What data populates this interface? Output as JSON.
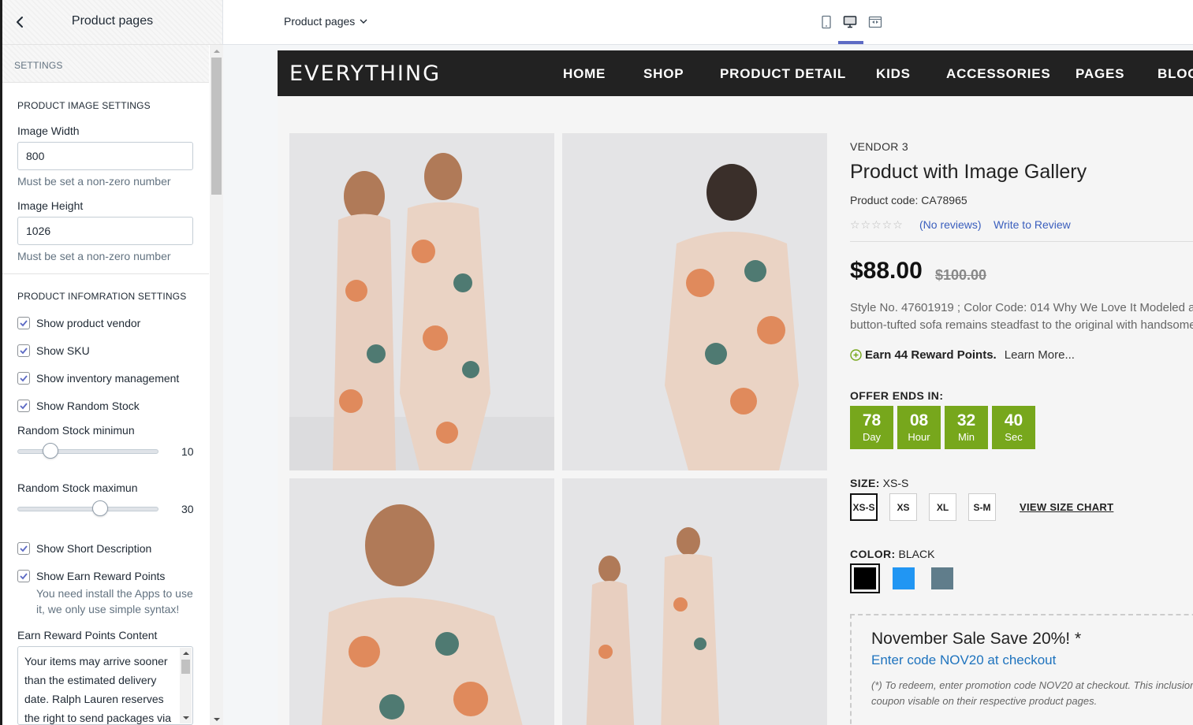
{
  "sidebar": {
    "title": "Product pages",
    "section": "SETTINGS",
    "image_settings": {
      "title": "PRODUCT IMAGE SETTINGS",
      "width_label": "Image Width",
      "width_value": "800",
      "width_help": "Must be set a non-zero number",
      "height_label": "Image Height",
      "height_value": "1026",
      "height_help": "Must be set a non-zero number"
    },
    "info_settings": {
      "title": "PRODUCT INFOMRATION SETTINGS",
      "show_vendor": "Show product vendor",
      "show_sku": "Show SKU",
      "show_inventory": "Show inventory management",
      "show_random_stock": "Show Random Stock",
      "stock_min_label": "Random Stock minimun",
      "stock_min_value": "10",
      "stock_min_fraction": 0.2,
      "stock_max_label": "Random Stock maximun",
      "stock_max_value": "30",
      "stock_max_fraction": 0.6,
      "show_short_desc": "Show Short Description",
      "show_reward": "Show Earn Reward Points",
      "reward_help": "You need install the Apps to use it, we only use simple syntax!",
      "reward_content_label": "Earn Reward Points Content",
      "reward_content": "Your items may arrive sooner than the estimated delivery date. Ralph Lauren reserves the right to send packages via"
    }
  },
  "topbar": {
    "page_select": "Product pages",
    "active_device": "desktop"
  },
  "store": {
    "logo": "EVERYTHING",
    "nav": [
      "HOME",
      "SHOP",
      "PRODUCT DETAIL",
      "KIDS",
      "ACCESSORIES",
      "PAGES",
      "BLOG"
    ]
  },
  "product": {
    "vendor": "VENDOR 3",
    "title": "Product with Image Gallery",
    "code": "Product code: CA78965",
    "stars": "☆☆☆☆☆",
    "no_reviews": "(No reviews)",
    "write_review": "Write to Review",
    "price": "$88.00",
    "old_price": "$100.00",
    "desc_line1": "Style No. 47601919 ; Color Code: 014 Why We Love It Modeled after",
    "desc_line2": "button-tufted sofa remains steadfast to the original with handsome",
    "reward_bold": "Earn 44 Reward Points.",
    "reward_link": "Learn More...",
    "offer_label": "OFFER ENDS IN:",
    "countdown": [
      {
        "n": "78",
        "u": "Day"
      },
      {
        "n": "08",
        "u": "Hour"
      },
      {
        "n": "32",
        "u": "Min"
      },
      {
        "n": "40",
        "u": "Sec"
      }
    ],
    "size_label": "SIZE:",
    "size_value": "XS-S",
    "sizes": [
      "XS-S",
      "XS",
      "XL",
      "S-M"
    ],
    "size_chart": "VIEW SIZE CHART",
    "color_label": "COLOR:",
    "color_value": "BLACK",
    "colors": [
      "#000000",
      "#2196f3",
      "#607d8b"
    ],
    "promo_title": "November Sale Save 20%! *",
    "promo_code": "Enter code NOV20 at checkout",
    "promo_note": "(*) To redeem, enter promotion code NOV20 at checkout. This inclusion this coupon visable on their respective product pages."
  },
  "colors": {
    "countdown_green": "#77a71c",
    "nav_bg": "#222222",
    "link_blue": "#3a5ebd",
    "accent": "#5c6ac4"
  }
}
